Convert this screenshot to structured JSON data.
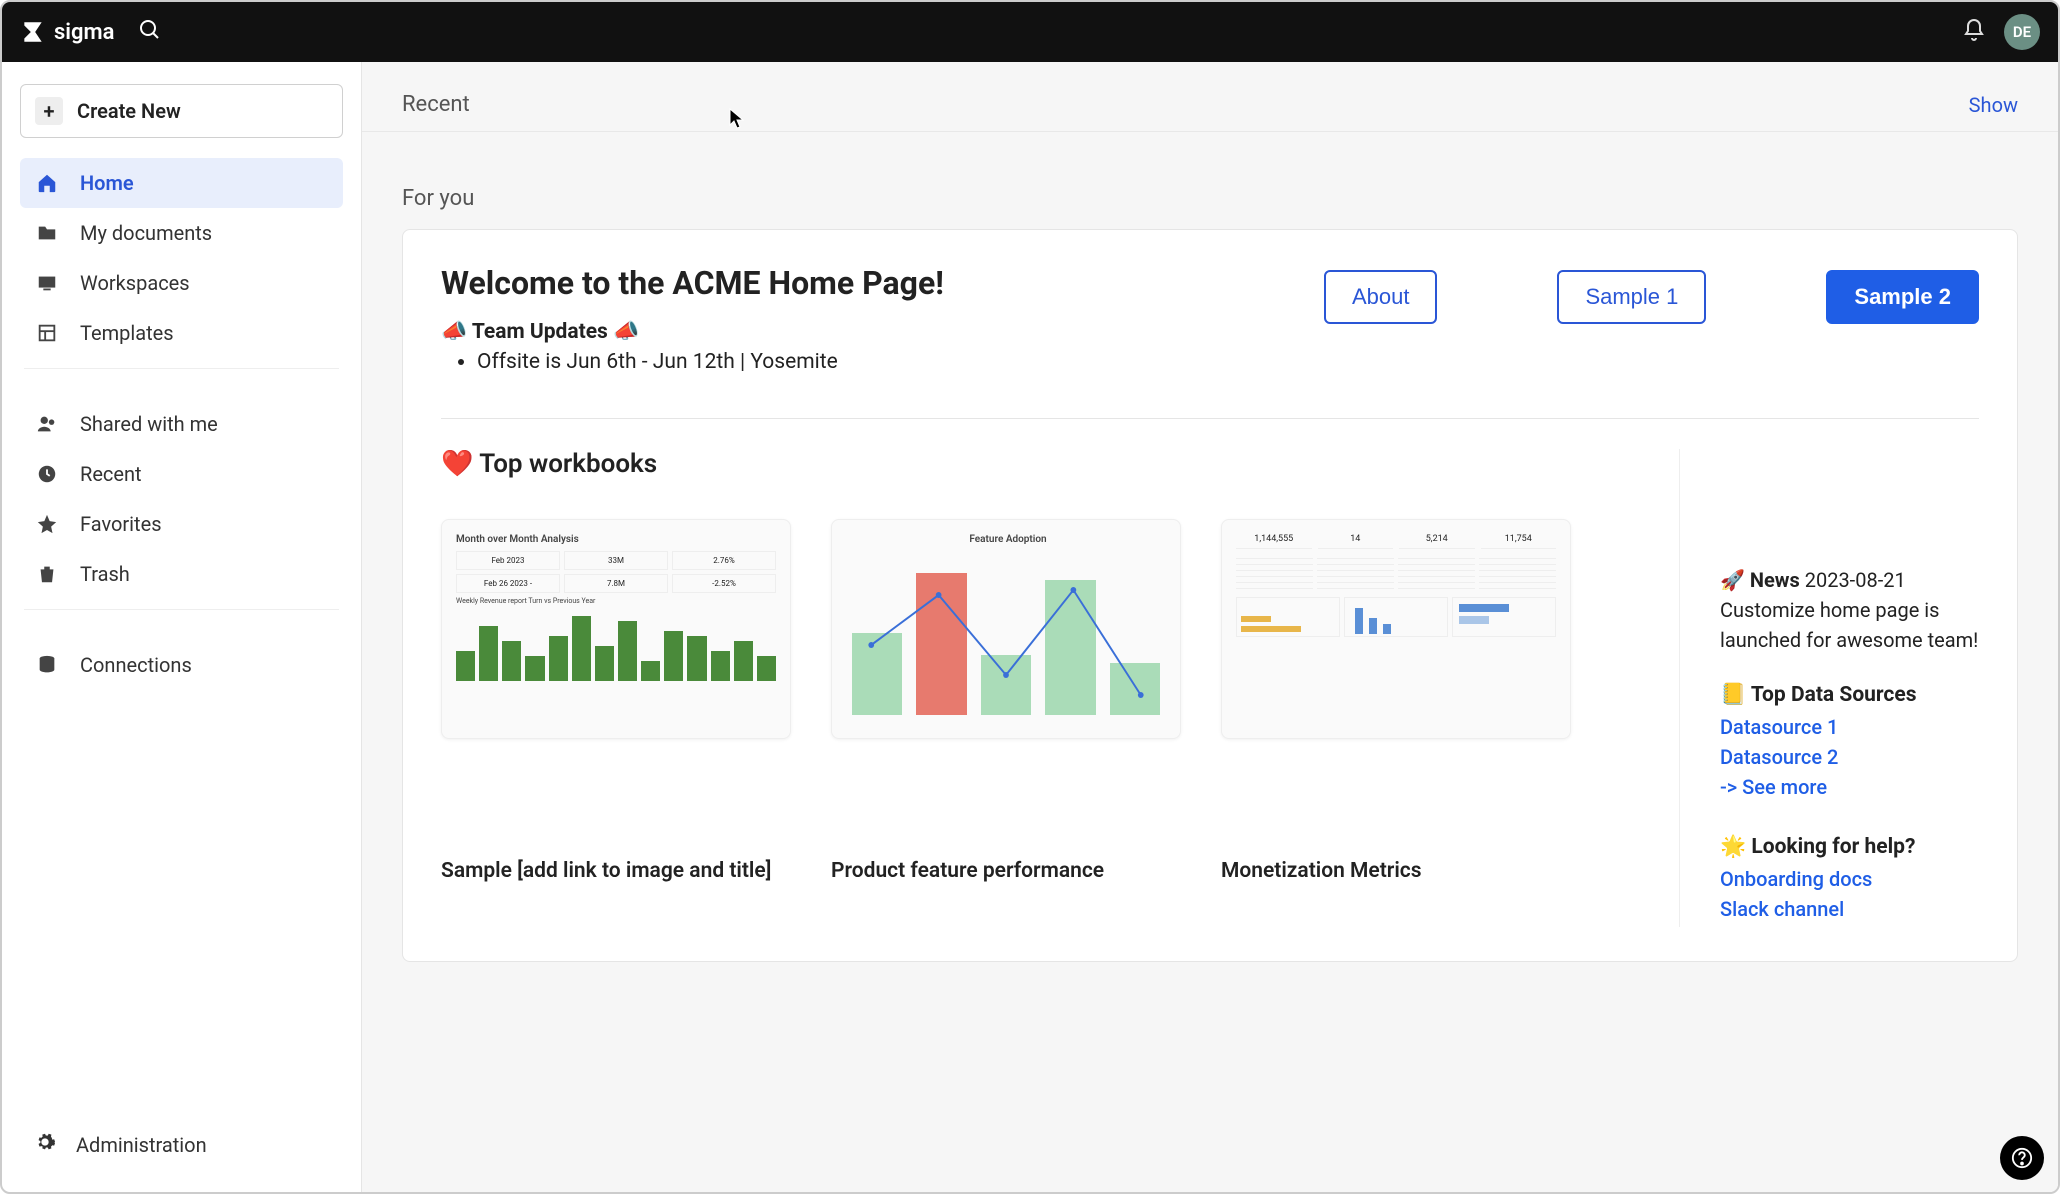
{
  "topbar": {
    "brand": "sigma",
    "avatar_initials": "DE"
  },
  "sidebar": {
    "create_label": "Create New",
    "items": [
      {
        "label": "Home",
        "icon": "home",
        "active": true
      },
      {
        "label": "My documents",
        "icon": "folder"
      },
      {
        "label": "Workspaces",
        "icon": "workspace"
      },
      {
        "label": "Templates",
        "icon": "template"
      }
    ],
    "items2": [
      {
        "label": "Shared with me",
        "icon": "people"
      },
      {
        "label": "Recent",
        "icon": "clock"
      },
      {
        "label": "Favorites",
        "icon": "star"
      },
      {
        "label": "Trash",
        "icon": "trash"
      }
    ],
    "items3": [
      {
        "label": "Connections",
        "icon": "db"
      }
    ],
    "admin_label": "Administration"
  },
  "main": {
    "recent_label": "Recent",
    "show_label": "Show",
    "for_you_label": "For you",
    "welcome_title": "Welcome to the ACME Home Page!",
    "team_updates_label": "Team Updates",
    "updates": [
      "Offsite is Jun 6th - Jun 12th | Yosemite"
    ],
    "buttons": {
      "about": "About",
      "sample1": "Sample 1",
      "sample2": "Sample 2"
    },
    "top_workbooks_label": "❤️ Top workbooks",
    "workbooks": [
      {
        "title": "Sample [add link to image and title]"
      },
      {
        "title": "Product feature performance"
      },
      {
        "title": "Monetization Metrics"
      }
    ],
    "news": {
      "heading": "News",
      "date": "2023-08-21",
      "body": "Customize home page is launched for awesome team!"
    },
    "datasources": {
      "heading": "📒 Top Data Sources",
      "links": [
        "Datasource 1",
        "Datasource 2",
        "-> See more"
      ]
    },
    "help": {
      "heading": "🌟 Looking for help?",
      "links": [
        "Onboarding docs",
        "Slack channel"
      ]
    }
  },
  "thumb1": {
    "title": "Month over Month Analysis",
    "row1": [
      "Feb 2023",
      "33M",
      "2.76%"
    ],
    "row2": [
      "Feb 26 2023 -",
      "7.8M",
      "-2.52%"
    ],
    "sub": "Weekly Revenue report Turn vs Previous Year",
    "bars": [
      30,
      55,
      40,
      25,
      45,
      65,
      35,
      60,
      20,
      50,
      45,
      30,
      40,
      25
    ]
  },
  "thumb2": {
    "title": "Feature Adoption",
    "bars": [
      55,
      95,
      40,
      90,
      35
    ],
    "red_index": 1
  },
  "thumb3": {
    "kpis": [
      "1,144,555",
      "14",
      "5,214",
      "11,754"
    ]
  }
}
